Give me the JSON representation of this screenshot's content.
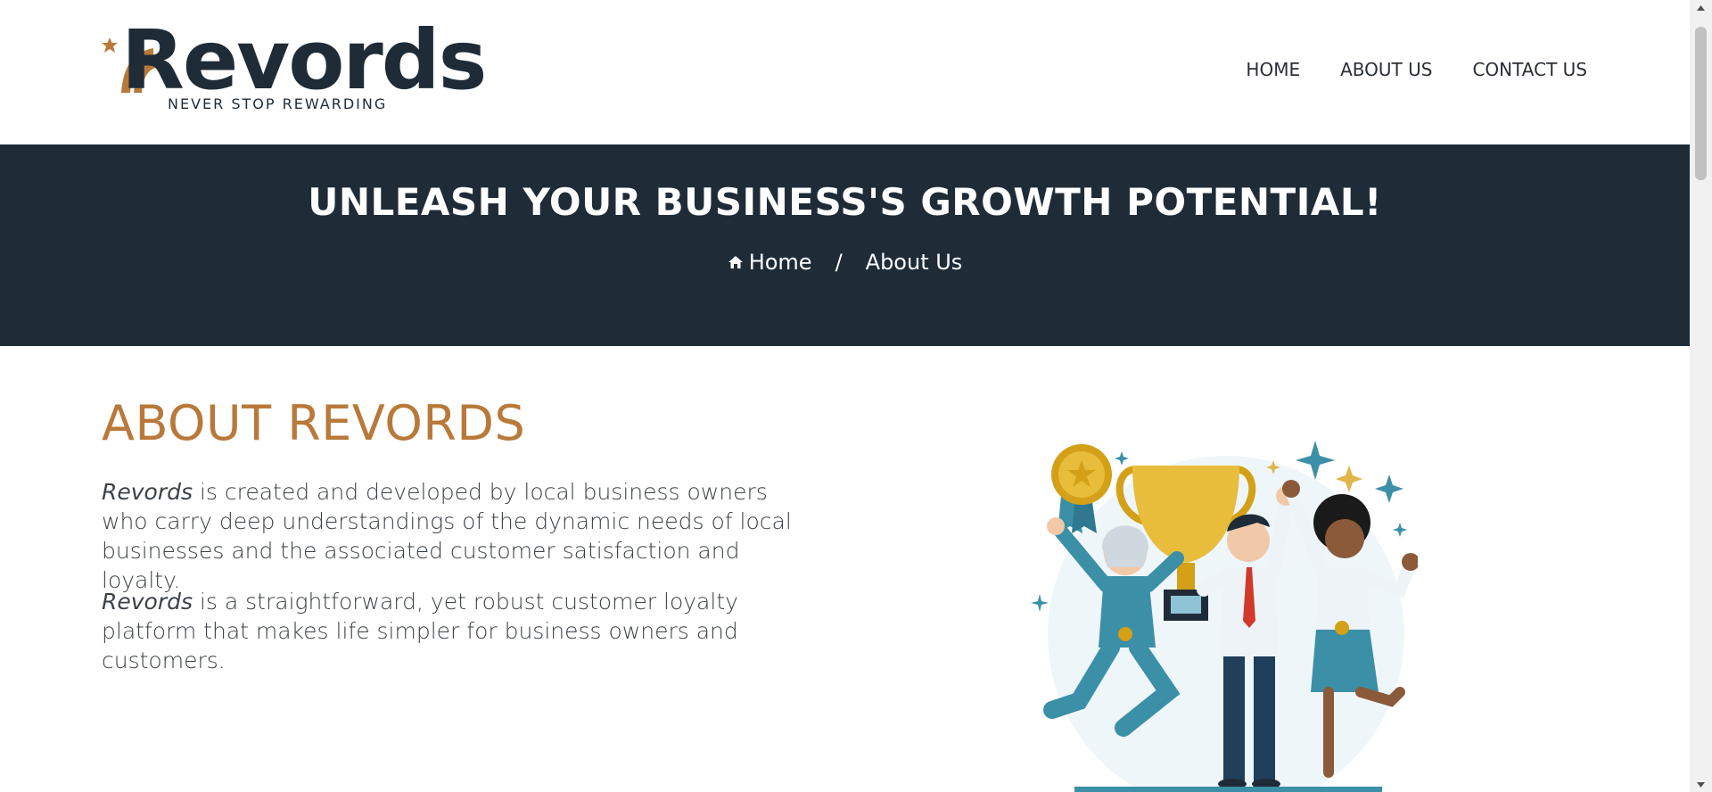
{
  "header": {
    "logo": {
      "word": "Revords",
      "tagline": "NEVER STOP REWARDING"
    },
    "nav": [
      {
        "label": "HOME"
      },
      {
        "label": "ABOUT US"
      },
      {
        "label": "CONTACT US"
      }
    ]
  },
  "banner": {
    "title": "UNLEASH YOUR BUSINESS'S GROWTH POTENTIAL!",
    "breadcrumb": {
      "home": "Home",
      "separator": "/",
      "current": "About Us"
    }
  },
  "about": {
    "heading": "ABOUT REVORDS",
    "p1_brand": "Revords",
    "p1_text": " is created and developed by local business owners who carry deep understandings of the dynamic needs of local businesses and the associated customer satisfaction and loyalty.",
    "p2_brand": "Revords",
    "p2_text": " is a straightforward, yet robust customer loyalty platform that makes life simpler for business owners and customers."
  },
  "colors": {
    "dark": "#1f2c38",
    "accent": "#b8793a",
    "gold": "#d4a017",
    "teal": "#3b8fa6"
  },
  "icons": [
    "home-icon",
    "star-icon",
    "scroll-up-icon",
    "scroll-down-icon"
  ]
}
